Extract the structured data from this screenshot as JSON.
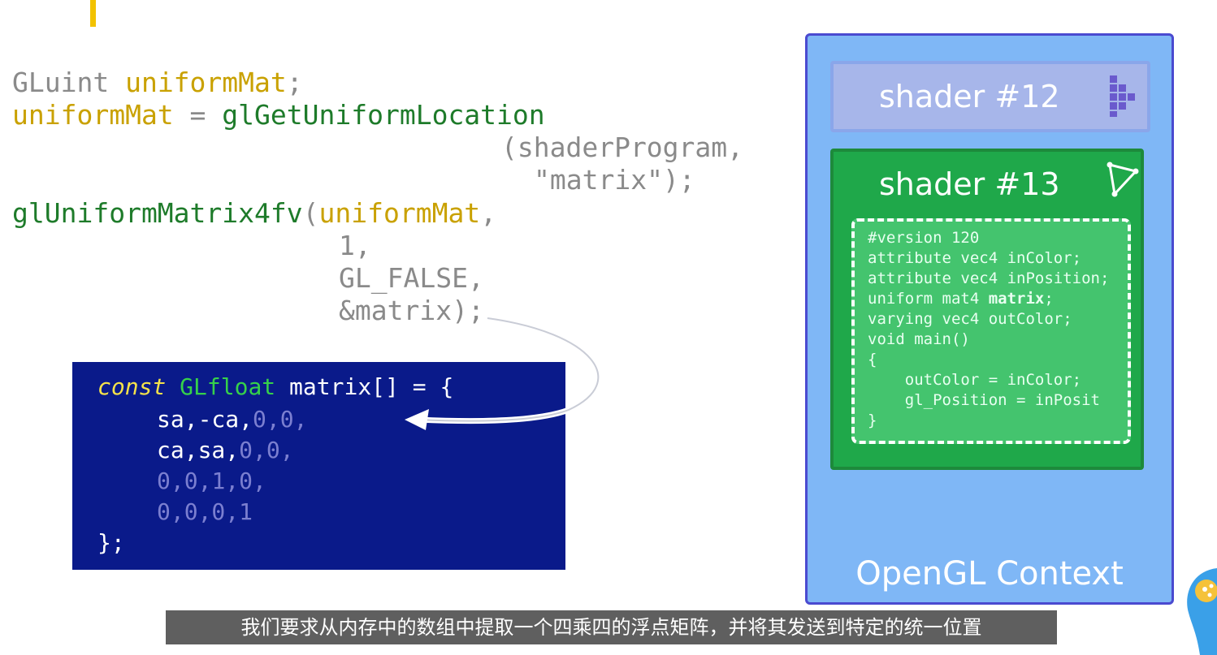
{
  "code": {
    "line1_type": "GLuint ",
    "line1_var": "uniformMat",
    "line1_end": ";",
    "line2_var": "uniformMat",
    "line2_eq": " = ",
    "line2_fn": "glGetUniformLocation",
    "line3": "(shaderProgram,",
    "line4": "\"matrix\");",
    "line5_fn": "glUniformMatrix4fv",
    "line5_paren": "(",
    "line5_arg": "uniformMat",
    "line5_comma": ",",
    "line6": "1,",
    "line7": "GL_FALSE,",
    "line8": "&matrix);"
  },
  "matrix_block": {
    "kw": "const",
    "type": "GLfloat",
    "decl": " matrix[] = {",
    "r1a": "sa,-ca,",
    "r1b": "0,0,",
    "r2a": "ca,sa,",
    "r2b": "0,0,",
    "r3a": "0,0,",
    "r3b": "1,",
    "r3c": "0,",
    "r4a": "0,0,0,",
    "r4b": "1",
    "close": "};"
  },
  "context": {
    "label": "OpenGL Context",
    "shader12": "shader #12",
    "shader13": "shader #13",
    "source_lines": [
      "#version 120",
      "attribute vec4 inColor;",
      "attribute vec4 inPosition;",
      "uniform mat4 ",
      "varying vec4 outColor;",
      "void main()",
      "{",
      "    outColor = inColor;",
      "    gl_Position = inPosit",
      "}"
    ],
    "source_bold": "matrix",
    "source_bold_end": ";"
  },
  "subtitle": "我们要求从内存中的数组中提取一个四乘四的浮点矩阵，并将其发送到特定的统一位置",
  "colors": {
    "accent": "#f2c200",
    "matrix_bg": "#0a1a8a",
    "context_bg": "#7fb7f6",
    "shader13_bg": "#1fa84a"
  }
}
